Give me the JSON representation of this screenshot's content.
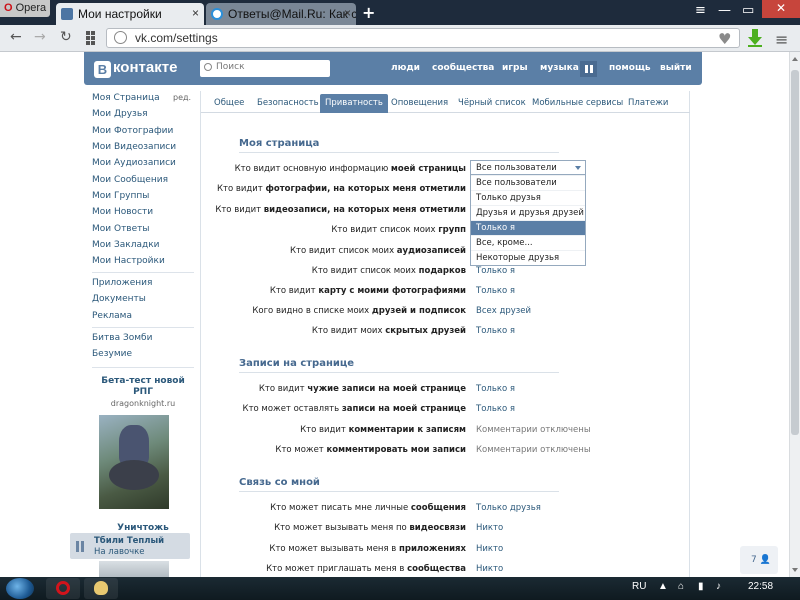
{
  "browser": {
    "menu_label": "Opera",
    "tabs": [
      {
        "title": "Мои настройки",
        "close": "×"
      },
      {
        "title": "Ответы@Mail.Ru: Как скр",
        "close": "×"
      }
    ],
    "new_tab": "+",
    "window_controls": {
      "minimize": "—",
      "restore": "▭",
      "close": "✕",
      "tabs_menu": "≡"
    },
    "url": "vk.com/settings"
  },
  "vk": {
    "logo_badge": "В",
    "logo_text": "контакте",
    "search_placeholder": "Поиск",
    "nav": [
      "люди",
      "сообщества",
      "игры",
      "музыка",
      "помощь",
      "выйти"
    ]
  },
  "left_menu": {
    "items": [
      "Моя Страница",
      "Мои Друзья",
      "Мои Фотографии",
      "Мои Видеозаписи",
      "Мои Аудиозаписи",
      "Мои Сообщения",
      "Мои Группы",
      "Мои Новости",
      "Мои Ответы",
      "Мои Закладки",
      "Мои Настройки"
    ],
    "edit_label": "ред.",
    "apps": [
      "Приложения",
      "Документы",
      "Реклама"
    ],
    "games": [
      "Битва Зомби",
      "Безумие"
    ],
    "promo": {
      "title": "Бета-тест новой РПГ",
      "url": "dragonknight.ru"
    },
    "promo2": {
      "title": "Уничтожь"
    }
  },
  "settings_tabs": [
    {
      "label": "Общее",
      "selected": false
    },
    {
      "label": "Безопасность",
      "selected": false
    },
    {
      "label": "Приватность",
      "selected": true
    },
    {
      "label": "Оповещения",
      "selected": false
    },
    {
      "label": "Чёрный список",
      "selected": false
    },
    {
      "label": "Мобильные сервисы",
      "selected": false
    },
    {
      "label": "Платежи",
      "selected": false
    }
  ],
  "sections": [
    {
      "title": "Моя страница",
      "rows": [
        {
          "pre": "Кто видит основную информацию ",
          "bold": "моей страницы",
          "post": "",
          "value": "Все пользователи"
        },
        {
          "pre": "Кто видит ",
          "bold": "фотографии, на которых меня отметили",
          "post": "",
          "value": ""
        },
        {
          "pre": "Кто видит ",
          "bold": "видеозаписи, на которых меня отметили",
          "post": "",
          "value": ""
        },
        {
          "pre": "Кто видит список моих ",
          "bold": "групп",
          "post": "",
          "value": ""
        },
        {
          "pre": "Кто видит список моих ",
          "bold": "аудиозаписей",
          "post": "",
          "value": ""
        },
        {
          "pre": "Кто видит список моих ",
          "bold": "подарков",
          "post": "",
          "value": "Только я"
        },
        {
          "pre": "Кто видит ",
          "bold": "карту с моими фотографиями",
          "post": "",
          "value": "Только я"
        },
        {
          "pre": "Кого видно в списке моих ",
          "bold": "друзей и подписок",
          "post": "",
          "value": "Всех друзей"
        },
        {
          "pre": "Кто видит моих ",
          "bold": "скрытых друзей",
          "post": "",
          "value": "Только я"
        }
      ]
    },
    {
      "title": "Записи на странице",
      "rows": [
        {
          "pre": "Кто видит ",
          "bold": "чужие записи на моей странице",
          "post": "",
          "value": "Только я",
          "muted": false
        },
        {
          "pre": "Кто может оставлять ",
          "bold": "записи на моей странице",
          "post": "",
          "value": "Только я",
          "muted": false
        },
        {
          "pre": "Кто видит ",
          "bold": "комментарии к записям",
          "post": "",
          "value": "Комментарии отключены",
          "muted": true
        },
        {
          "pre": "Кто может ",
          "bold": "комментировать мои записи",
          "post": "",
          "value": "Комментарии отключены",
          "muted": true
        }
      ]
    },
    {
      "title": "Связь со мной",
      "rows": [
        {
          "pre": "Кто может писать мне личные ",
          "bold": "сообщения",
          "post": "",
          "value": "Только друзья",
          "muted": false
        },
        {
          "pre": "Кто может вызывать меня по ",
          "bold": "видеосвязи",
          "post": "",
          "value": "Никто",
          "muted": false
        },
        {
          "pre": "Кто может вызывать меня в ",
          "bold": "приложениях",
          "post": "",
          "value": "Никто",
          "muted": false
        },
        {
          "pre": "Кто может приглашать меня в ",
          "bold": "сообщества",
          "post": "",
          "value": "Никто",
          "muted": false
        }
      ]
    }
  ],
  "dropdown": {
    "current": "Все пользователи",
    "options": [
      "Все пользователи",
      "Только друзья",
      "Друзья и друзья друзей",
      "Только я",
      "Все, кроме...",
      "Некоторые друзья"
    ],
    "highlighted_index": 3
  },
  "audio_player": {
    "title": "Тбили Теплый",
    "subtitle": "На лавочке"
  },
  "online_counter": "7",
  "taskbar": {
    "lang": "RU",
    "time": "22:58"
  },
  "colors": {
    "vk_blue": "#5b7fa6",
    "link": "#2b587a",
    "taskbar": "#0f1a20"
  }
}
